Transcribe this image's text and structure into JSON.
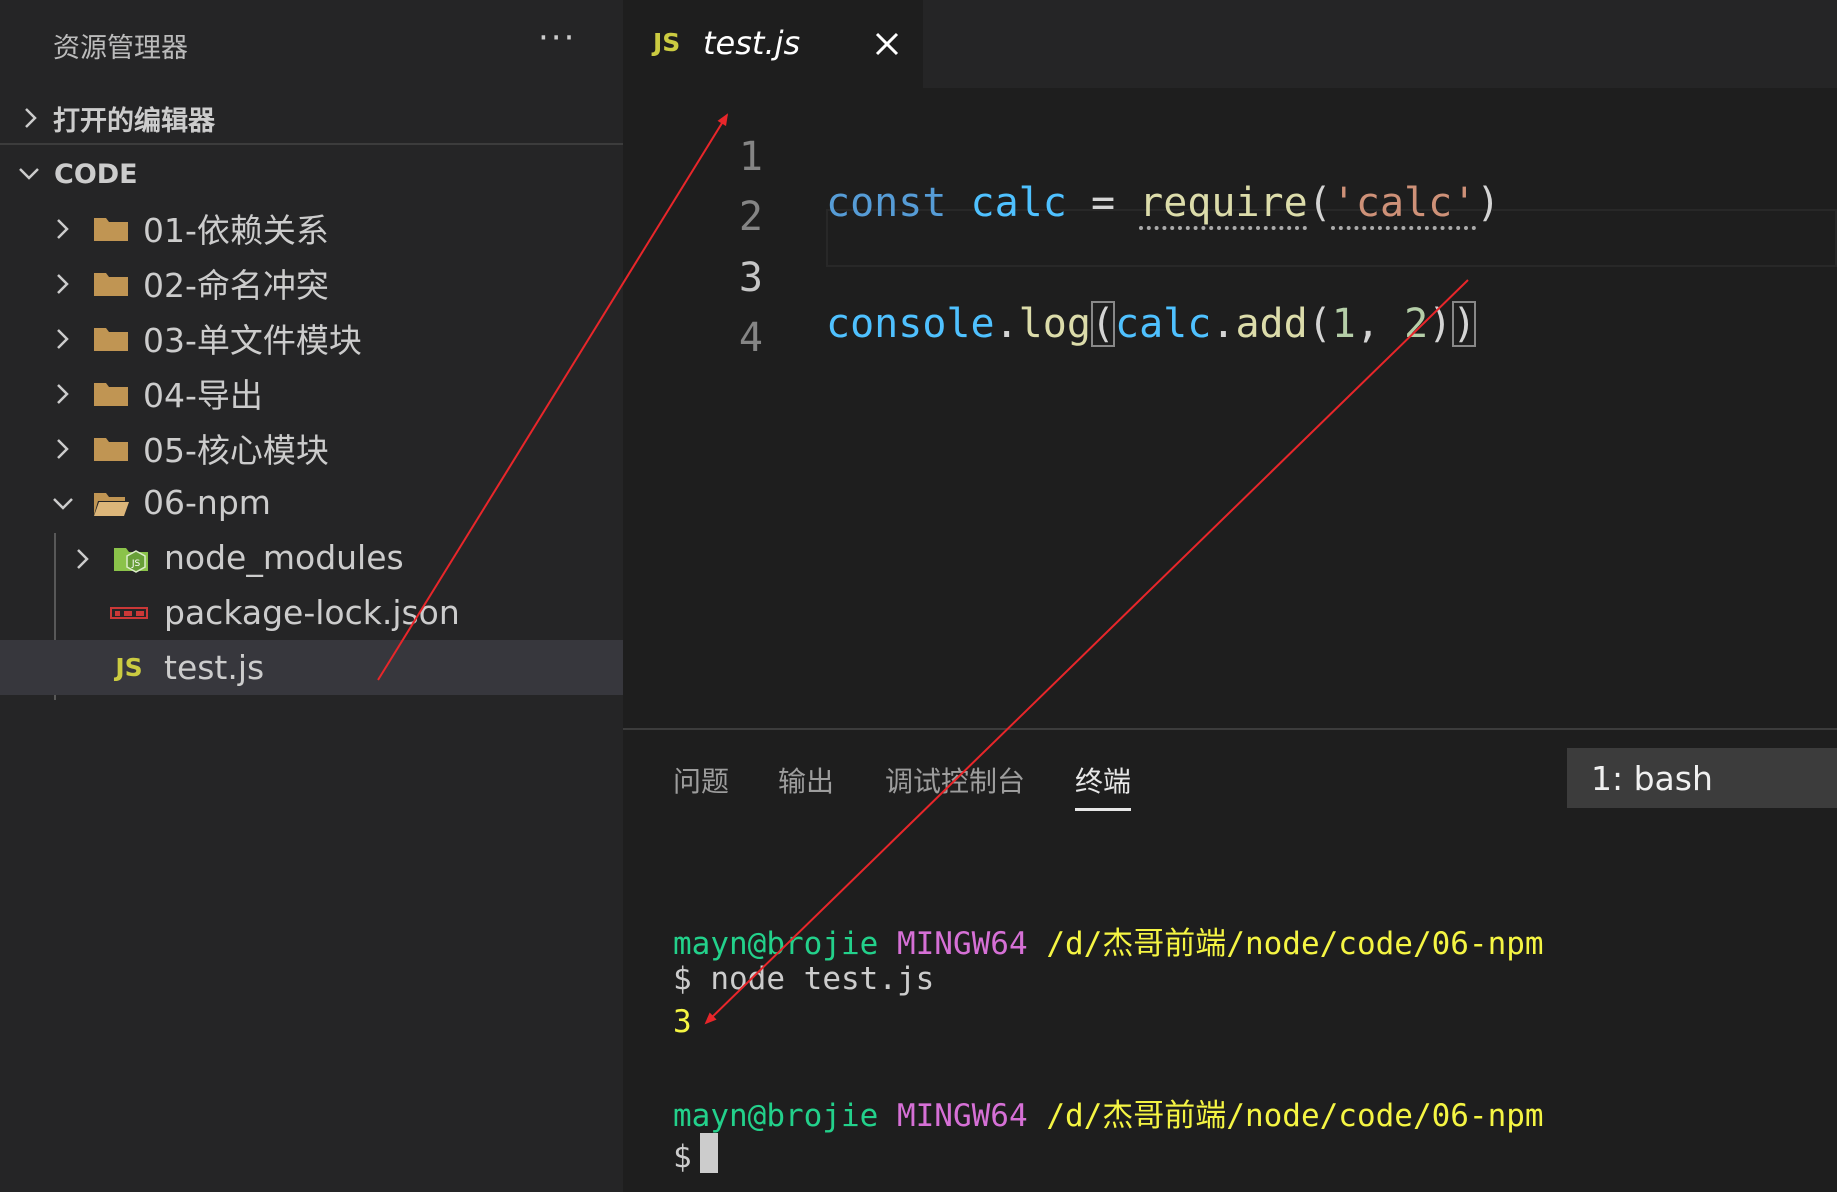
{
  "explorer": {
    "title": "资源管理器",
    "more_label": "···",
    "open_editors_label": "打开的编辑器",
    "workspace_label": "CODE",
    "items": [
      {
        "label": "01-依赖关系"
      },
      {
        "label": "02-命名冲突"
      },
      {
        "label": "03-单文件模块"
      },
      {
        "label": "04-导出"
      },
      {
        "label": "05-核心模块"
      },
      {
        "label": "06-npm"
      },
      {
        "label": "node_modules"
      },
      {
        "label": "package-lock.json"
      },
      {
        "label": "test.js"
      }
    ],
    "js_badge": "JS"
  },
  "editor": {
    "tab": {
      "badge": "JS",
      "title": "test.js"
    },
    "line_numbers": [
      "1",
      "2",
      "3",
      "4"
    ],
    "active_line": 3,
    "code": {
      "line1": {
        "kw": "const",
        "var": "calc",
        "op": "=",
        "fn": "require",
        "open": "(",
        "str": "'calc'",
        "close": ")"
      },
      "line3": {
        "obj": "console",
        "dot1": ".",
        "method": "log",
        "open1": "(",
        "var": "calc",
        "dot2": ".",
        "method2": "add",
        "open2": "(",
        "num1": "1",
        "comma": ",",
        "num2": "2",
        "close2": ")",
        "close1": ")"
      }
    }
  },
  "panel": {
    "tabs": [
      {
        "label": "问题"
      },
      {
        "label": "输出"
      },
      {
        "label": "调试控制台"
      },
      {
        "label": "终端"
      }
    ],
    "active_tab": "终端",
    "terminal_select": "1: bash",
    "terminal": {
      "user": "mayn@brojie",
      "system": "MINGW64",
      "path": "/d/杰哥前端/node/code/06-npm",
      "prompt": "$",
      "command": "node test.js",
      "output": "3"
    }
  },
  "colors": {
    "annotation_arrow": "#e8262a",
    "js_badge": "#cbcb41",
    "folder": "#c09553"
  }
}
